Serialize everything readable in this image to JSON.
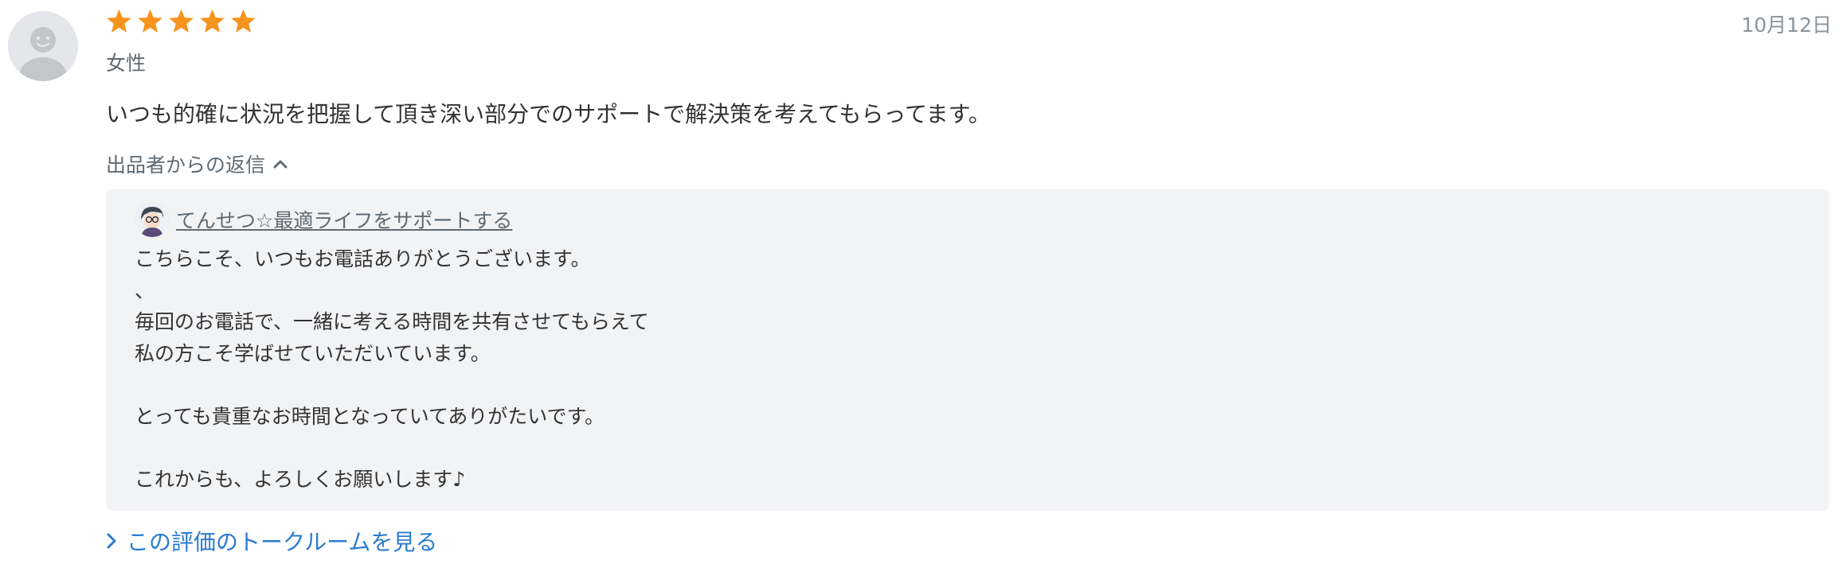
{
  "review": {
    "rating": 5,
    "star_count_max": 5,
    "star_color": "#F7941D",
    "date": "10月12日",
    "reviewer_gender": "女性",
    "text": "いつも的確に状況を把握して頂き深い部分でのサポートで解決策を考えてもらってます。",
    "reply_toggle_label": "出品者からの返信",
    "reply": {
      "seller_name": "てんせつ☆最適ライフをサポートする",
      "lines": [
        "こちらこそ、いつもお電話ありがとうございます。",
        "、",
        "毎回のお電話で、一緒に考える時間を共有させてもらえて",
        "私の方こそ学ばせていただいています。",
        "",
        "とっても貴重なお時間となっていてありがたいです。",
        "",
        "これからも、よろしくお願いします♪"
      ]
    },
    "talkroom_link_label": "この評価のトークルームを見る",
    "icons": {
      "reviewer_avatar": "user-avatar-icon",
      "star": "star-icon",
      "toggle": "chevron-up-icon",
      "link": "chevron-right-icon"
    },
    "colors": {
      "link": "#2A7BD0",
      "reply_bg": "#F2F3F5"
    }
  }
}
